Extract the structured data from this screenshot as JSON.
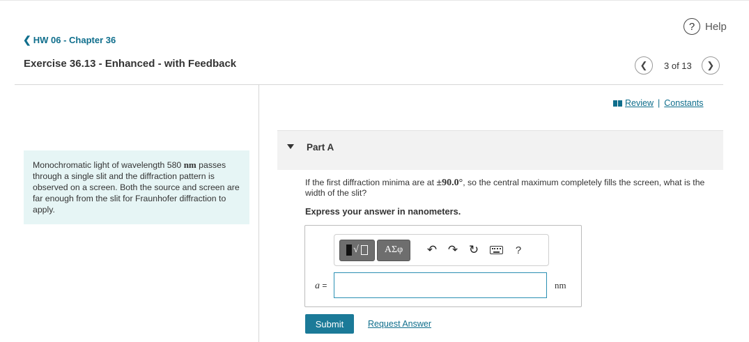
{
  "help": {
    "label": "Help",
    "icon": "question-circle-icon",
    "glyph": "?"
  },
  "breadcrumb": {
    "chevron": "❮",
    "label": "HW 06 - Chapter 36"
  },
  "exercise": {
    "title": "Exercise 36.13 - Enhanced - with Feedback"
  },
  "pager": {
    "prev": "❮",
    "next": "❯",
    "text": "3 of 13"
  },
  "links": {
    "review": "Review",
    "separator": "|",
    "constants": "Constants"
  },
  "problem": {
    "text_before": "Monochromatic light of wavelength 580 ",
    "unit": "nm",
    "text_after": " passes through a single slit and the diffraction pattern is observed on a screen. Both the source and screen are far enough from the slit for Fraunhofer diffraction to apply."
  },
  "part": {
    "title": "Part A"
  },
  "question": {
    "before": "If the first diffraction minima are at ",
    "value": "±90.0°",
    "after": ", so the central maximum completely fills the screen, what is the width of the slit?"
  },
  "instruction": "Express your answer in nanometers.",
  "toolbar": {
    "templates_sqrt": "√",
    "symbols_label": "ΑΣφ",
    "undo_glyph": "↶",
    "redo_glyph": "↷",
    "reset_glyph": "↻",
    "help_glyph": "?"
  },
  "answer": {
    "variable": "a",
    "equals": " =",
    "value": "",
    "placeholder": "",
    "unit": "nm"
  },
  "buttons": {
    "submit": "Submit",
    "request_answer": "Request Answer"
  },
  "colors": {
    "link": "#0f6e8c",
    "submit_bg": "#1b7a98",
    "problem_bg": "#e6f5f5",
    "input_border": "#2a8fb3"
  }
}
